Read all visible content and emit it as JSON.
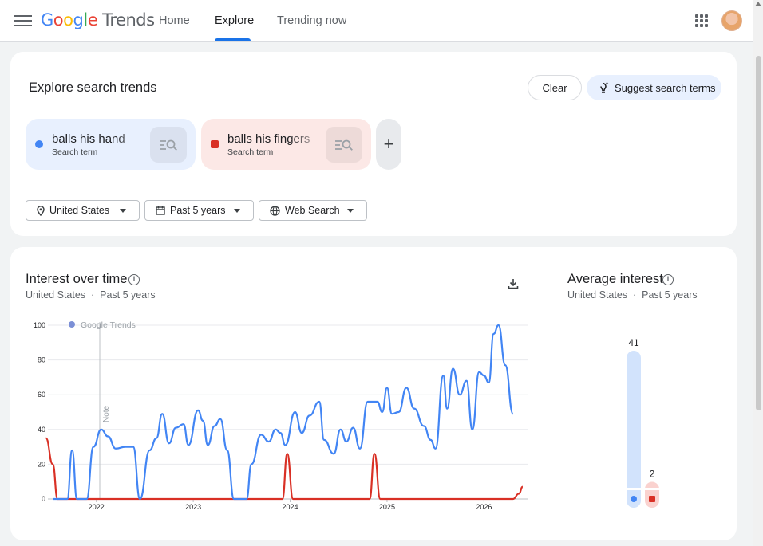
{
  "nav": {
    "logo_google": [
      "G",
      "o",
      "o",
      "g",
      "l",
      "e"
    ],
    "logo_trends": "Trends",
    "tabs": [
      {
        "label": "Home",
        "active": false
      },
      {
        "label": "Explore",
        "active": true
      },
      {
        "label": "Trending now",
        "active": false
      }
    ],
    "accent_color": "#1a73e8"
  },
  "explore": {
    "title": "Explore search trends",
    "clear_label": "Clear",
    "suggest_label": "Suggest search terms",
    "terms": [
      {
        "name": "balls his hand",
        "type": "Search term",
        "color": "#4285f4",
        "icon": "circle-marker"
      },
      {
        "name": "balls his fingers",
        "type": "Search term",
        "color": "#d93025",
        "icon": "square-marker"
      }
    ],
    "add_icon": "+",
    "filters": [
      {
        "label": "United States",
        "icon": "location-pin-icon"
      },
      {
        "label": "Past 5 years",
        "icon": "calendar-icon"
      },
      {
        "label": "Web Search",
        "icon": "globe-icon"
      }
    ]
  },
  "interest": {
    "title": "Interest over time",
    "region": "United States",
    "separator": "·",
    "range": "Past 5 years",
    "watermark": "Google Trends",
    "note_label": "Note"
  },
  "average": {
    "title": "Average interest",
    "region": "United States",
    "separator": "·",
    "range": "Past 5 years"
  },
  "chart_data": [
    {
      "type": "line",
      "title": "Interest over time",
      "x_tick_labels": [
        "2022",
        "2023",
        "2024",
        "2025",
        "2026"
      ],
      "x_tick_positions": [
        2022,
        2023,
        2024,
        2025,
        2026
      ],
      "xlim": [
        2021.5,
        2026.45
      ],
      "ylim": [
        0,
        100
      ],
      "y_ticks": [
        0,
        20,
        40,
        60,
        80,
        100
      ],
      "grid": true,
      "series": [
        {
          "name": "balls his hand",
          "color": "#4285f4",
          "points": [
            [
              2021.55,
              0
            ],
            [
              2021.7,
              0
            ],
            [
              2021.75,
              28
            ],
            [
              2021.8,
              0
            ],
            [
              2021.9,
              0
            ],
            [
              2021.97,
              30
            ],
            [
              2022.05,
              40
            ],
            [
              2022.12,
              36
            ],
            [
              2022.2,
              29
            ],
            [
              2022.3,
              30
            ],
            [
              2022.38,
              30
            ],
            [
              2022.45,
              0
            ],
            [
              2022.55,
              28
            ],
            [
              2022.62,
              35
            ],
            [
              2022.68,
              49
            ],
            [
              2022.75,
              32
            ],
            [
              2022.82,
              41
            ],
            [
              2022.9,
              43
            ],
            [
              2022.95,
              31
            ],
            [
              2023.05,
              51
            ],
            [
              2023.1,
              45
            ],
            [
              2023.15,
              31
            ],
            [
              2023.22,
              42
            ],
            [
              2023.28,
              46
            ],
            [
              2023.35,
              28
            ],
            [
              2023.42,
              0
            ],
            [
              2023.55,
              0
            ],
            [
              2023.6,
              20
            ],
            [
              2023.7,
              37
            ],
            [
              2023.78,
              33
            ],
            [
              2023.85,
              40
            ],
            [
              2023.9,
              38
            ],
            [
              2023.95,
              31
            ],
            [
              2024.05,
              50
            ],
            [
              2024.12,
              38
            ],
            [
              2024.2,
              48
            ],
            [
              2024.3,
              56
            ],
            [
              2024.35,
              34
            ],
            [
              2024.45,
              26
            ],
            [
              2024.52,
              40
            ],
            [
              2024.58,
              33
            ],
            [
              2024.65,
              41
            ],
            [
              2024.72,
              29
            ],
            [
              2024.8,
              56
            ],
            [
              2024.9,
              56
            ],
            [
              2024.95,
              50
            ],
            [
              2025.0,
              64
            ],
            [
              2025.05,
              49
            ],
            [
              2025.12,
              50
            ],
            [
              2025.2,
              64
            ],
            [
              2025.28,
              52
            ],
            [
              2025.38,
              42
            ],
            [
              2025.45,
              34
            ],
            [
              2025.5,
              29
            ],
            [
              2025.58,
              71
            ],
            [
              2025.62,
              52
            ],
            [
              2025.68,
              75
            ],
            [
              2025.75,
              60
            ],
            [
              2025.82,
              68
            ],
            [
              2025.88,
              40
            ],
            [
              2025.95,
              73
            ],
            [
              2026.0,
              71
            ],
            [
              2026.05,
              67
            ],
            [
              2026.1,
              95
            ],
            [
              2026.15,
              100
            ],
            [
              2026.22,
              77
            ],
            [
              2026.3,
              49
            ]
          ]
        },
        {
          "name": "balls his fingers",
          "color": "#d93025",
          "points": [
            [
              2021.48,
              35
            ],
            [
              2021.55,
              20
            ],
            [
              2021.6,
              0
            ],
            [
              2021.62,
              0
            ],
            [
              2023.92,
              0
            ],
            [
              2023.97,
              26
            ],
            [
              2024.03,
              0
            ],
            [
              2024.06,
              0
            ],
            [
              2024.82,
              0
            ],
            [
              2024.87,
              26
            ],
            [
              2024.93,
              0
            ],
            [
              2024.95,
              0
            ],
            [
              2026.3,
              0
            ],
            [
              2026.36,
              3
            ],
            [
              2026.4,
              7
            ]
          ]
        }
      ]
    },
    {
      "type": "bar",
      "title": "Average interest",
      "categories": [
        "balls his hand",
        "balls his fingers"
      ],
      "values": [
        41,
        2
      ],
      "colors": [
        "#4285f4",
        "#d93025"
      ],
      "ylim": [
        0,
        41
      ]
    }
  ]
}
